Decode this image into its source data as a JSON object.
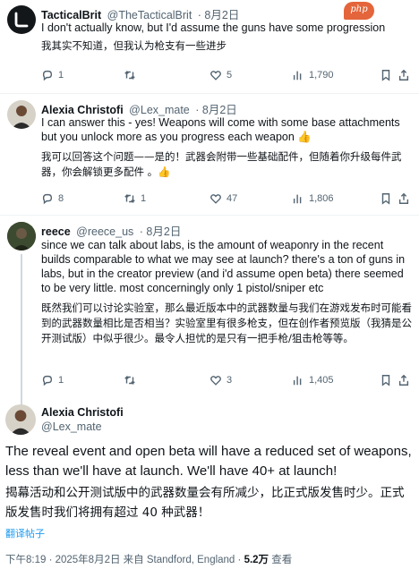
{
  "watermark": "php",
  "tweets": [
    {
      "name": "TacticalBrit",
      "handle": "@TheTacticalBrit",
      "date": "· 8月2日",
      "text_en": "I don't actually know, but I'd assume the guns have some progression",
      "text_zh": "我其实不知道，但我认为枪支有一些进步",
      "replies": "1",
      "retweets": "",
      "likes": "5",
      "views": "1,790"
    },
    {
      "name": "Alexia Christofi",
      "handle": "@Lex_mate",
      "date": "· 8月2日",
      "text_en": "I can answer this - yes! Weapons will come with some base attachments but you unlock more as you progress each weapon 👍",
      "text_zh": "我可以回答这个问题——是的！武器会附带一些基础配件，但随着你升级每件武器，你会解锁更多配件 。👍",
      "replies": "8",
      "retweets": "1",
      "likes": "47",
      "views": "1,806"
    },
    {
      "name": "reece",
      "handle": "@reece_us",
      "date": "· 8月2日",
      "text_en": "since we can talk about labs, is the amount of weaponry in the recent builds comparable to what we may see at launch? there's a ton of guns in labs, but in the creator preview (and i'd assume open beta) there seemed to be very little. most concerningly only 1 pistol/sniper etc",
      "text_zh": "既然我们可以讨论实验室，那么最近版本中的武器数量与我们在游戏发布时可能看到的武器数量相比是否相当？实验室里有很多枪支，但在创作者预览版（我猜是公开测试版）中似乎很少。最令人担忧的是只有一把手枪/狙击枪等等。",
      "replies": "1",
      "retweets": "",
      "likes": "3",
      "views": "1,405"
    }
  ],
  "main": {
    "name": "Alexia Christofi",
    "handle": "@Lex_mate",
    "text_en": "The reveal event and open beta will have a reduced set of weapons, less than we'll have at launch. We'll have 40+ at launch!",
    "text_zh": "揭幕活动和公开测试版中的武器数量会有所减少，比正式版发售时少。正式版发售时我们将拥有超过 40 种武器！",
    "translate_label": "翻译帖子",
    "meta_time": "下午8:19 · 2025年8月2日 来自 Standford, England · ",
    "meta_views": "5.2万",
    "meta_views_label": " 查看"
  }
}
